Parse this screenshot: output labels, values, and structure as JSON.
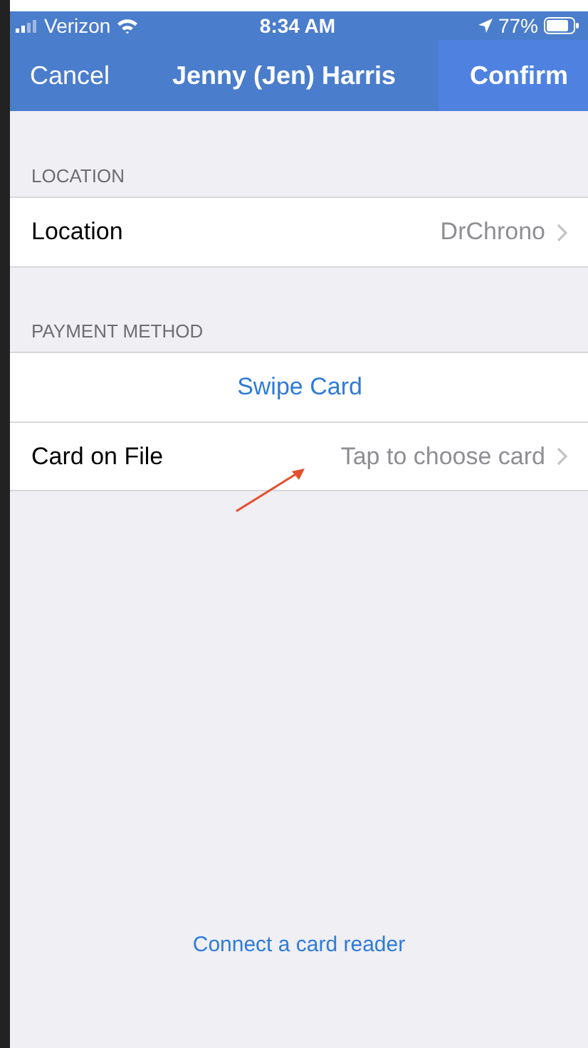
{
  "status_bar": {
    "carrier": "Verizon",
    "time": "8:34 AM",
    "battery": "77%"
  },
  "nav": {
    "cancel": "Cancel",
    "title": "Jenny (Jen) Harris",
    "confirm": "Confirm"
  },
  "sections": [
    {
      "header": "LOCATION",
      "rows": [
        {
          "kind": "detail",
          "label": "Location",
          "value": "DrChrono"
        }
      ]
    },
    {
      "header": "PAYMENT METHOD",
      "rows": [
        {
          "kind": "action",
          "label": "Swipe Card"
        },
        {
          "kind": "detail",
          "label": "Card on File",
          "value": "Tap to choose card"
        }
      ]
    }
  ],
  "footer_link": "Connect a card reader"
}
